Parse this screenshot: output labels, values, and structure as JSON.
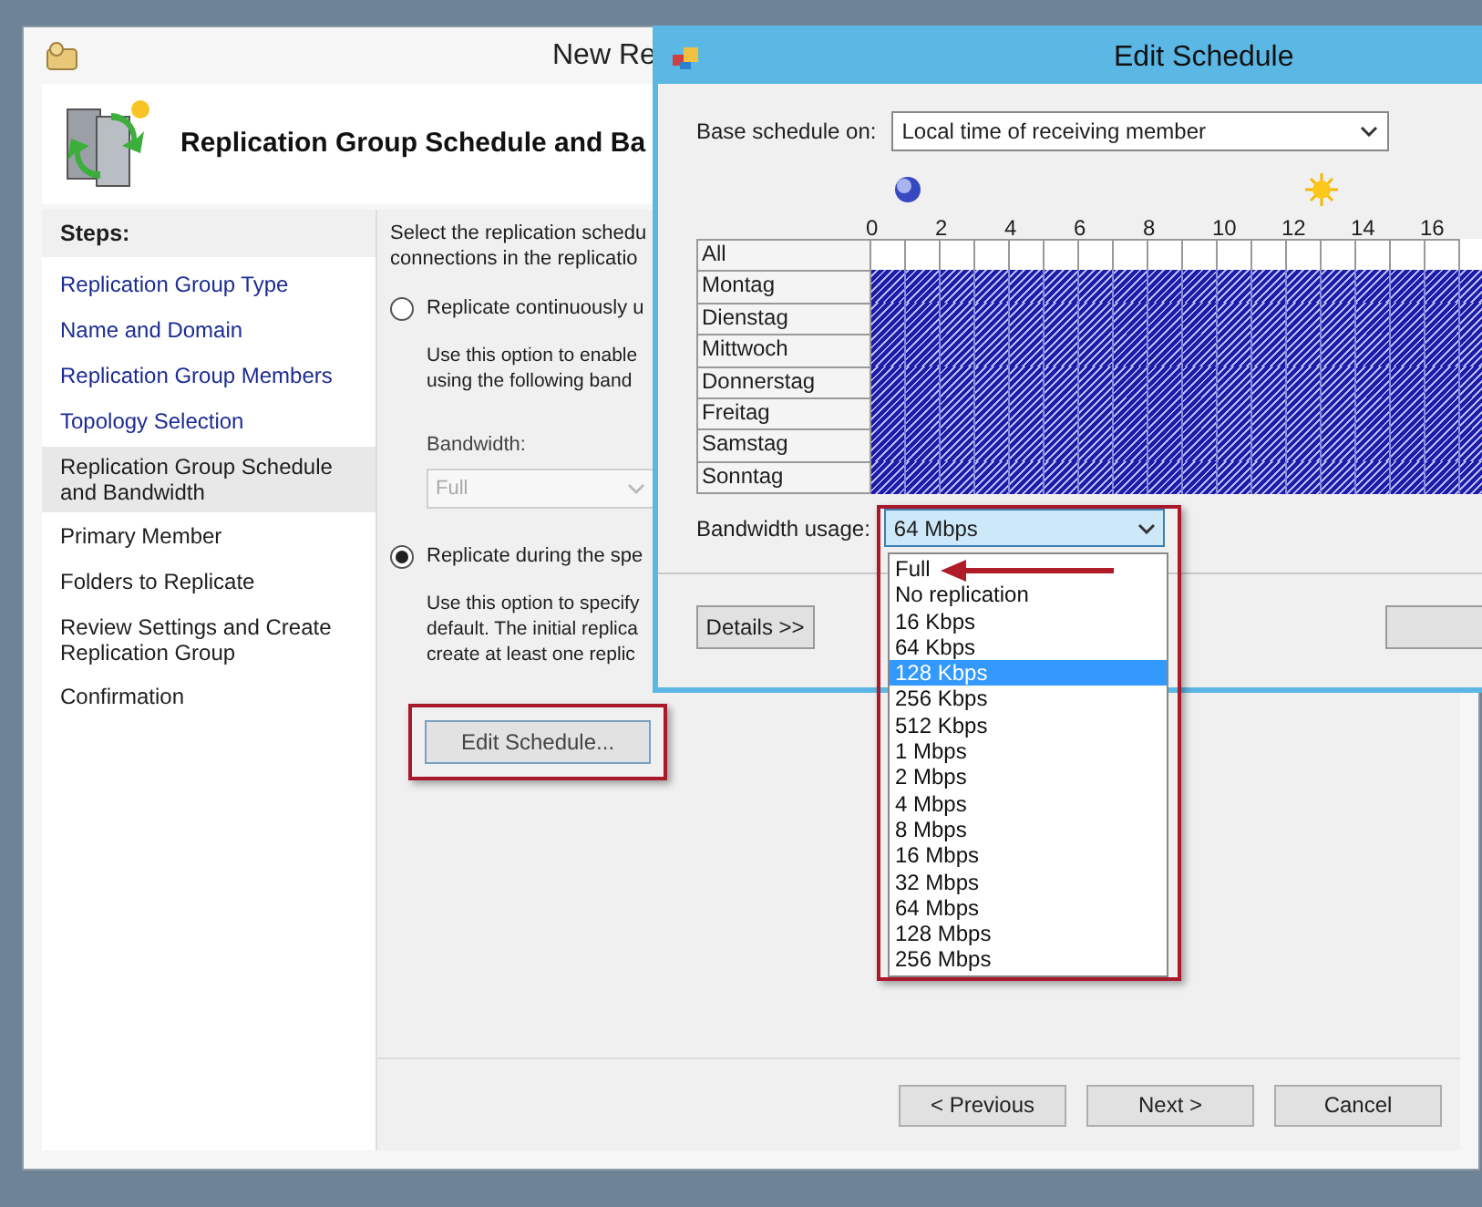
{
  "wizard": {
    "title": "New Re",
    "header": "Replication Group Schedule and Ba",
    "steps_heading": "Steps:",
    "steps": [
      {
        "label": "Replication Group Type",
        "visited": true,
        "selected": false
      },
      {
        "label": "Name and Domain",
        "visited": true,
        "selected": false
      },
      {
        "label": "Replication Group Members",
        "visited": true,
        "selected": false
      },
      {
        "label": "Topology Selection",
        "visited": true,
        "selected": false
      },
      {
        "label": "Replication Group Schedule and Bandwidth",
        "visited": false,
        "selected": true
      },
      {
        "label": "Primary Member",
        "visited": false,
        "selected": false
      },
      {
        "label": "Folders to Replicate",
        "visited": false,
        "selected": false
      },
      {
        "label": "Review Settings and Create Replication Group",
        "visited": false,
        "selected": false
      },
      {
        "label": "Confirmation",
        "visited": false,
        "selected": false
      }
    ],
    "intro": [
      "Select the replication schedu",
      "connections in the replicatio"
    ],
    "options": [
      {
        "label": "Replicate continuously u",
        "selected": false,
        "description": [
          "Use this option to enable",
          "using the following band"
        ]
      },
      {
        "label": "Replicate during the spe",
        "selected": true,
        "description": [
          "Use this option to specify",
          "default. The initial replica",
          "create at least one replic"
        ]
      }
    ],
    "bandwidth": {
      "label": "Bandwidth:",
      "value": "Full",
      "disabled": true
    },
    "edit_button": "Edit Schedule...",
    "buttons": [
      "< Previous",
      "Next >",
      "Cancel"
    ]
  },
  "dialog": {
    "title": "Edit Schedule",
    "base_label": "Base schedule on:",
    "base_value": "Local time of receiving member",
    "hours": [
      "0",
      "2",
      "4",
      "6",
      "8",
      "10",
      "12",
      "14",
      "16"
    ],
    "rows": [
      {
        "day": "All",
        "on": false
      },
      {
        "day": "Montag",
        "on": true
      },
      {
        "day": "Dienstag",
        "on": true
      },
      {
        "day": "Mittwoch",
        "on": true
      },
      {
        "day": "Donnerstag",
        "on": true
      },
      {
        "day": "Freitag",
        "on": true
      },
      {
        "day": "Samstag",
        "on": true
      },
      {
        "day": "Sonntag",
        "on": true
      }
    ],
    "bandwidth_label": "Bandwidth usage:",
    "bandwidth_value": "64 Mbps",
    "expanded": true,
    "options": [
      {
        "label": "Full",
        "selected": false
      },
      {
        "label": "No replication",
        "selected": false
      },
      {
        "label": "16 Kbps",
        "selected": false
      },
      {
        "label": "64 Kbps",
        "selected": false
      },
      {
        "label": "128 Kbps",
        "selected": true
      },
      {
        "label": "256 Kbps",
        "selected": false
      },
      {
        "label": "512 Kbps",
        "selected": false
      },
      {
        "label": "1 Mbps",
        "selected": false
      },
      {
        "label": "2 Mbps",
        "selected": false
      },
      {
        "label": "4 Mbps",
        "selected": false
      },
      {
        "label": "8 Mbps",
        "selected": false
      },
      {
        "label": "16 Mbps",
        "selected": false
      },
      {
        "label": "32 Mbps",
        "selected": false
      },
      {
        "label": "64 Mbps",
        "selected": false
      },
      {
        "label": "128 Mbps",
        "selected": false
      },
      {
        "label": "256 Mbps",
        "selected": false
      }
    ],
    "details_button": "Details >>"
  }
}
